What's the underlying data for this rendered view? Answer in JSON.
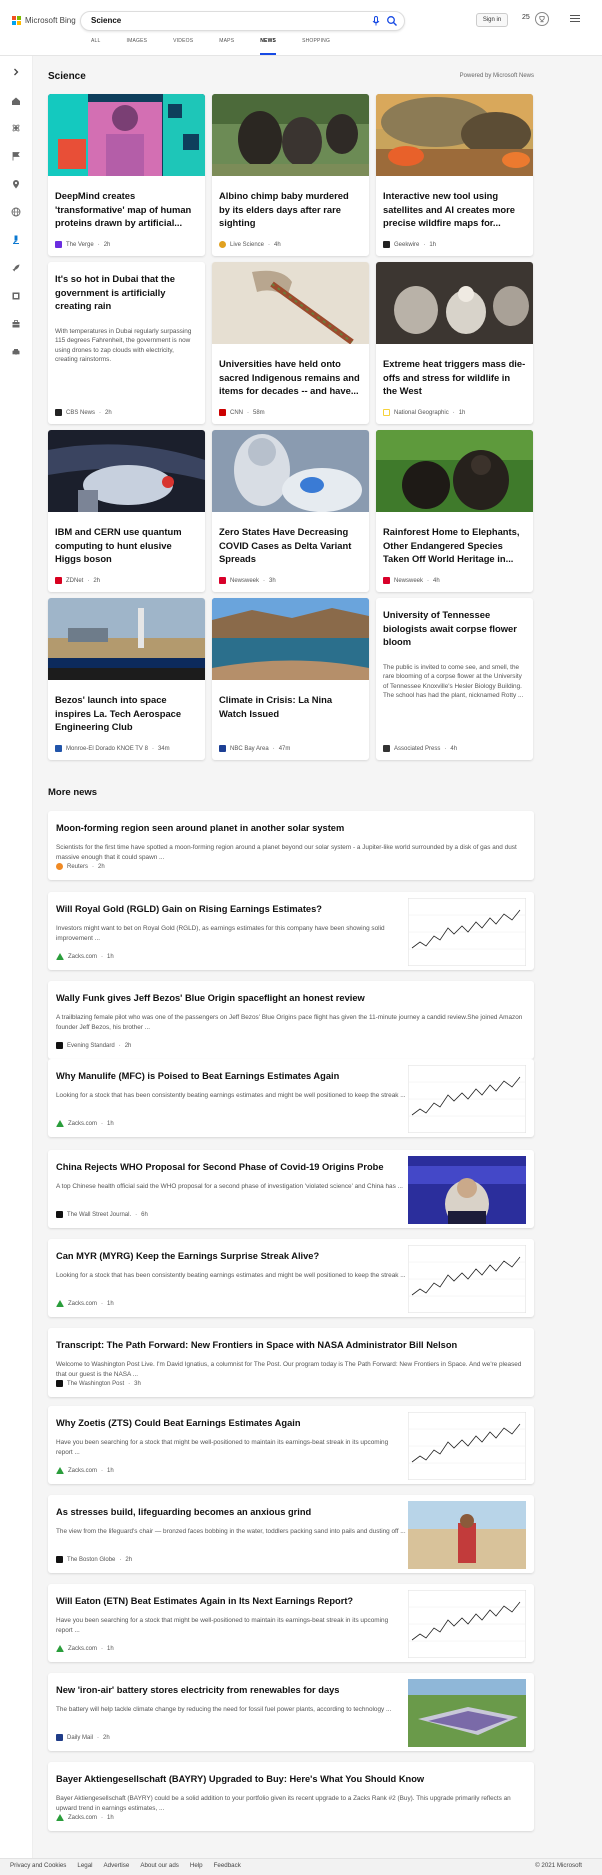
{
  "header": {
    "logo_text": "Microsoft Bing",
    "search_value": "Science",
    "signin_label": "Sign in",
    "rewards_count": "25",
    "tabs": [
      {
        "label": "ALL"
      },
      {
        "label": "IMAGES"
      },
      {
        "label": "VIDEOS"
      },
      {
        "label": "MAPS"
      },
      {
        "label": "NEWS",
        "active": true
      },
      {
        "label": "SHOPPING"
      }
    ]
  },
  "sidebar": {
    "icons": [
      "chevron-right-icon",
      "home-icon",
      "science-icon",
      "flag-icon",
      "location-icon",
      "globe-icon",
      "microscope-icon",
      "rocket-icon",
      "film-icon",
      "briefcase-icon",
      "car-icon"
    ]
  },
  "science": {
    "title": "Science",
    "powered_by": "Powered by Microsoft News",
    "cards": [
      {
        "title": "DeepMind creates 'transformative' map of human proteins drawn by artificial...",
        "source": "The Verge",
        "time": "2h",
        "image": true
      },
      {
        "title": "Albino chimp baby murdered by its elders days after rare sighting",
        "source": "Live Science",
        "time": "4h",
        "image": true
      },
      {
        "title": "Interactive new tool using satellites and AI creates more precise wildfire maps for...",
        "source": "Geekwire",
        "time": "1h",
        "image": true
      },
      {
        "title": "It's so hot in Dubai that the government is artificially creating rain",
        "snippet": "With temperatures in Dubai regularly surpassing 115 degrees Fahrenheit, the government is now using drones to zap clouds with electricity, creating rainstorms.",
        "source": "CBS News",
        "time": "2h",
        "image": false
      },
      {
        "title": "Universities have held onto sacred Indigenous remains and items for decades -- and have...",
        "source": "CNN",
        "time": "58m",
        "image": true
      },
      {
        "title": "Extreme heat triggers mass die-offs and stress for wildlife in the West",
        "source": "National Geographic",
        "time": "1h",
        "image": true
      },
      {
        "title": "IBM and CERN use quantum computing to hunt elusive Higgs boson",
        "source": "ZDNet",
        "time": "2h",
        "image": true
      },
      {
        "title": "Zero States Have Decreasing COVID Cases as Delta Variant Spreads",
        "source": "Newsweek",
        "time": "3h",
        "image": true
      },
      {
        "title": "Rainforest Home to Elephants, Other Endangered Species Taken Off World Heritage in...",
        "source": "Newsweek",
        "time": "4h",
        "image": true
      },
      {
        "title": "Bezos' launch into space inspires La. Tech Aerospace Engineering Club",
        "source": "Monroe-El Dorado KNOE TV 8",
        "time": "34m",
        "image": true
      },
      {
        "title": "Climate in Crisis: La Nina Watch Issued",
        "source": "NBC Bay Area",
        "time": "47m",
        "image": true
      },
      {
        "title": "University of Tennessee biologists await corpse flower bloom",
        "snippet": "The public is invited to come see, and smell, the rare blooming of a corpse flower at the University of Tennessee Knoxville's Hesler Biology Building. The school has had the plant, nicknamed Rotty ...",
        "source": "Associated Press",
        "time": "4h",
        "image": false
      }
    ]
  },
  "more_news": {
    "title": "More news",
    "items": [
      {
        "title": "Moon-forming region seen around planet in another solar system",
        "snippet": "Scientists for the first time have spotted a moon-forming region around a planet beyond our solar system - a Jupiter-like world surrounded by a disk of gas and dust massive enough that it could spawn ...",
        "source": "Reuters",
        "time": "2h",
        "thumb": false
      },
      {
        "title": "Will Royal Gold (RGLD) Gain on Rising Earnings Estimates?",
        "snippet": "Investors might want to bet on Royal Gold (RGLD), as earnings estimates for this company have been showing solid improvement ...",
        "source": "Zacks.com",
        "time": "1h",
        "thumb": "chart"
      },
      {
        "title": "Wally Funk gives Jeff Bezos' Blue Origin spaceflight an honest review",
        "snippet": "A trailblazing female pilot who was one of the passengers on Jeff Bezos' Blue Origins pace flight has given the 11-minute journey a candid review.She joined Amazon founder Jeff Bezos, his brother ...",
        "source": "Evening Standard",
        "time": "2h",
        "thumb": false
      },
      {
        "title": "Why Manulife (MFC) is Poised to Beat Earnings Estimates Again",
        "snippet": "Looking for a stock that has been consistently beating earnings estimates and might be well positioned to keep the streak ...",
        "source": "Zacks.com",
        "time": "1h",
        "thumb": "chart"
      },
      {
        "title": "China Rejects WHO Proposal for Second Phase of Covid-19 Origins Probe",
        "snippet": "A top Chinese health official said the WHO proposal for a second phase of investigation 'violated science' and China has ...",
        "source": "The Wall Street Journal.",
        "time": "6h",
        "thumb": "photo-blue"
      },
      {
        "title": "Can MYR (MYRG) Keep the Earnings Surprise Streak Alive?",
        "snippet": "Looking for a stock that has been consistently beating earnings estimates and might be well positioned to keep the streak ...",
        "source": "Zacks.com",
        "time": "1h",
        "thumb": "chart"
      },
      {
        "title": "Transcript: The Path Forward: New Frontiers in Space with NASA Administrator Bill Nelson",
        "snippet": "Welcome to Washington Post Live. I'm David Ignatius, a columnist for The Post. Our program today is The Path Forward: New Frontiers in Space. And we're pleased that our guest is the NASA ...",
        "source": "The Washington Post",
        "time": "3h",
        "thumb": false
      },
      {
        "title": "Why Zoetis (ZTS) Could Beat Earnings Estimates Again",
        "snippet": "Have you been searching for a stock that might be well-positioned to maintain its earnings-beat streak in its upcoming report ...",
        "source": "Zacks.com",
        "time": "1h",
        "thumb": "chart"
      },
      {
        "title": "As stresses build, lifeguarding becomes an anxious grind",
        "snippet": "The view from the lifeguard's chair — bronzed faces bobbing in the water, toddlers packing sand into pails and dusting off ...",
        "source": "The Boston Globe",
        "time": "2h",
        "thumb": "photo-beach"
      },
      {
        "title": "Will Eaton (ETN) Beat Estimates Again in Its Next Earnings Report?",
        "snippet": "Have you been searching for a stock that might be well-positioned to maintain its earnings-beat streak in its upcoming report ...",
        "source": "Zacks.com",
        "time": "1h",
        "thumb": "chart"
      },
      {
        "title": "New 'iron-air' battery stores electricity from renewables for days",
        "snippet": "The battery will help tackle climate change by reducing the need for fossil fuel power plants, according to technology ...",
        "source": "Daily Mail",
        "time": "2h",
        "thumb": "photo-plant"
      },
      {
        "title": "Bayer Aktiengesellschaft (BAYRY) Upgraded to Buy: Here's What You Should Know",
        "snippet": "Bayer Aktiengesellschaft (BAYRY) could be a solid addition to your portfolio given its recent upgrade to a Zacks Rank #2 (Buy). This upgrade primarily reflects an upward trend in earnings estimates, ...",
        "source": "Zacks.com",
        "time": "1h",
        "thumb": false
      }
    ]
  },
  "footer": {
    "links": [
      "Privacy and Cookies",
      "Legal",
      "Advertise",
      "About our ads",
      "Help",
      "Feedback"
    ],
    "copyright": "© 2021 Microsoft"
  }
}
